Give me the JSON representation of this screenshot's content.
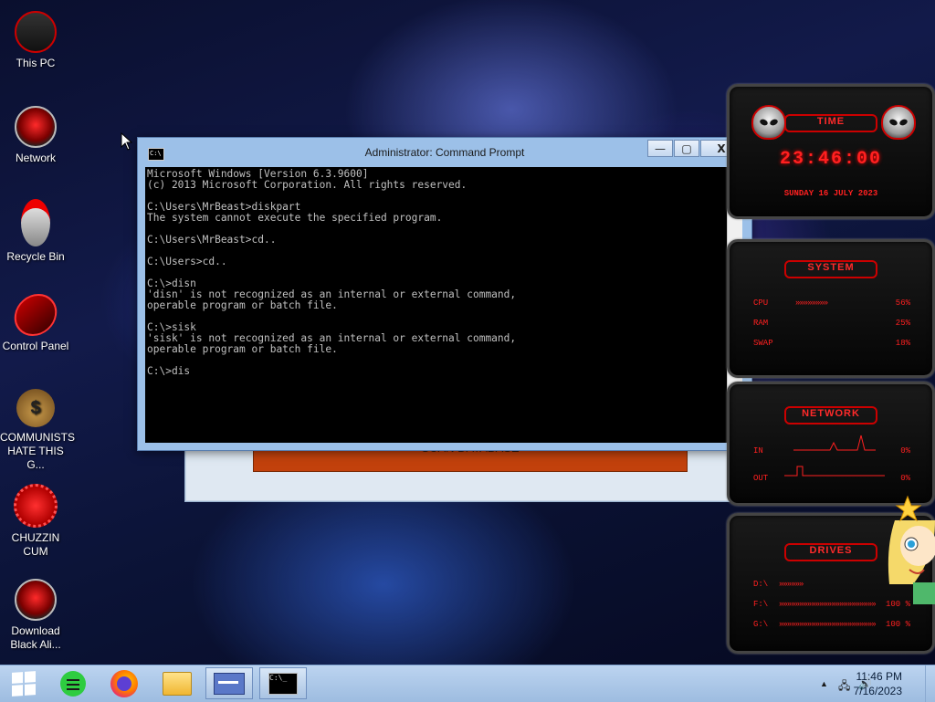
{
  "desktop": {
    "icons": [
      {
        "label": "This PC",
        "icon": "computer-icon"
      },
      {
        "label": "Network",
        "icon": "alien-network-icon"
      },
      {
        "label": "Recycle Bin",
        "icon": "recycle-bin-icon"
      },
      {
        "label": "Control Panel",
        "icon": "control-panel-icon"
      },
      {
        "label": "COMMUNISTS HATE THIS G...",
        "icon": "money-bag-icon"
      },
      {
        "label": "CHUZZIN CUM",
        "icon": "red-chuzzle-icon"
      },
      {
        "label": "Download Black Ali...",
        "icon": "alien-download-icon"
      }
    ]
  },
  "background_window": {
    "button_label": "SCAN DATABASE"
  },
  "cmd": {
    "title": "Administrator: Command Prompt",
    "icon_text": "C:\\",
    "minimize": "—",
    "maximize": "▢",
    "close": "X",
    "output": "Microsoft Windows [Version 6.3.9600]\n(c) 2013 Microsoft Corporation. All rights reserved.\n\nC:\\Users\\MrBeast>diskpart\nThe system cannot execute the specified program.\n\nC:\\Users\\MrBeast>cd..\n\nC:\\Users>cd..\n\nC:\\>disn\n'disn' is not recognized as an internal or external command,\noperable program or batch file.\n\nC:\\>sisk\n'sisk' is not recognized as an internal or external command,\noperable program or batch file.\n\nC:\\>dis",
    "scroll_up": "▲",
    "scroll_down": "▼"
  },
  "widget": {
    "time": {
      "title": "TIME",
      "clock": "23:46:00",
      "date": "SUNDAY 16 JULY 2023"
    },
    "system": {
      "title": "SYSTEM",
      "rows": [
        {
          "label": "CPU",
          "bar": "»»»»»»»»",
          "value": "56%"
        },
        {
          "label": "RAM",
          "bar": "",
          "value": "25%"
        },
        {
          "label": "SWAP",
          "bar": "",
          "value": "18%"
        }
      ]
    },
    "network": {
      "title": "NETWORK",
      "rows": [
        {
          "label": "IN",
          "value": "0%"
        },
        {
          "label": "OUT",
          "value": "0%"
        }
      ]
    },
    "drives": {
      "title": "DRIVES",
      "rows": [
        {
          "label": "D:\\",
          "bar": "»»»»»»",
          "value": ""
        },
        {
          "label": "F:\\",
          "bar": "»»»»»»»»»»»»»»»»»»»»»»»»",
          "value": "100 %"
        },
        {
          "label": "G:\\",
          "bar": "»»»»»»»»»»»»»»»»»»»»»»»»",
          "value": "100 %"
        }
      ]
    }
  },
  "taskbar": {
    "items": [
      {
        "name": "start-button",
        "icon": "windows-logo-icon"
      },
      {
        "name": "notes-app-button",
        "icon": "notes-icon"
      },
      {
        "name": "firefox-button",
        "icon": "firefox-icon"
      },
      {
        "name": "file-explorer-button",
        "icon": "folder-icon"
      },
      {
        "name": "app-window-button",
        "icon": "app-window-icon"
      },
      {
        "name": "command-prompt-button",
        "icon": "cmd-icon"
      }
    ],
    "clock_time": "11:46 PM",
    "clock_date": "7/16/2023",
    "tray_chevron": "▲",
    "network_glyph": "🖧",
    "volume_glyph": "🔊"
  },
  "colors": {
    "accent_red": "#ff2020",
    "taskbar": "#a9c3e3",
    "console_bg": "#000000",
    "console_text": "#c0c0c0",
    "scan_button": "#c2410c"
  }
}
